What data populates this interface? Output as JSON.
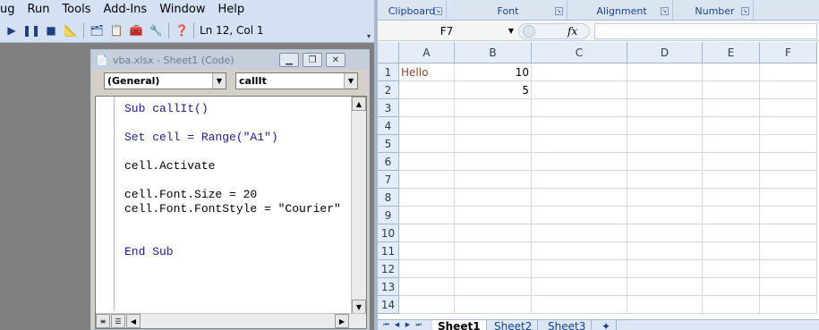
{
  "vba": {
    "menu": [
      "ug",
      "Run",
      "Tools",
      "Add-Ins",
      "Window",
      "Help"
    ],
    "menu_underline": [
      "",
      "R",
      "T",
      "A",
      "W",
      "H"
    ],
    "cursor_position": "Ln 12, Col 1",
    "code_window": {
      "title": "vba.xlsx - Sheet1 (Code)",
      "object_combo": "(General)",
      "procedure_combo": "callIt",
      "code_lines": [
        "Sub callIt()",
        "",
        "Set cell = Range(\"A1\")",
        "",
        "cell.Activate",
        "",
        "cell.Font.Size = 20",
        "cell.Font.FontStyle = \"Courier\"",
        "",
        "",
        "End Sub"
      ]
    }
  },
  "excel": {
    "ribbon_groups": [
      "Clipboard",
      "Font",
      "Alignment",
      "Number"
    ],
    "name_box": "F7",
    "fx": "fx",
    "formula": "",
    "columns": [
      "A",
      "B",
      "C",
      "D",
      "E",
      "F"
    ],
    "rows": [
      "1",
      "2",
      "3",
      "4",
      "5",
      "6",
      "7",
      "8",
      "9",
      "10",
      "11",
      "12",
      "13",
      "14"
    ],
    "cells": {
      "A1": "Hello",
      "B1": "10",
      "B2": "5"
    },
    "sheet_tabs": [
      "Sheet1",
      "Sheet2",
      "Sheet3"
    ],
    "active_sheet": "Sheet1"
  },
  "colors": {
    "vba_bar": "#d4e1f3",
    "excel_header": "#e4ecf7",
    "text_cell": "#9c3d20"
  }
}
